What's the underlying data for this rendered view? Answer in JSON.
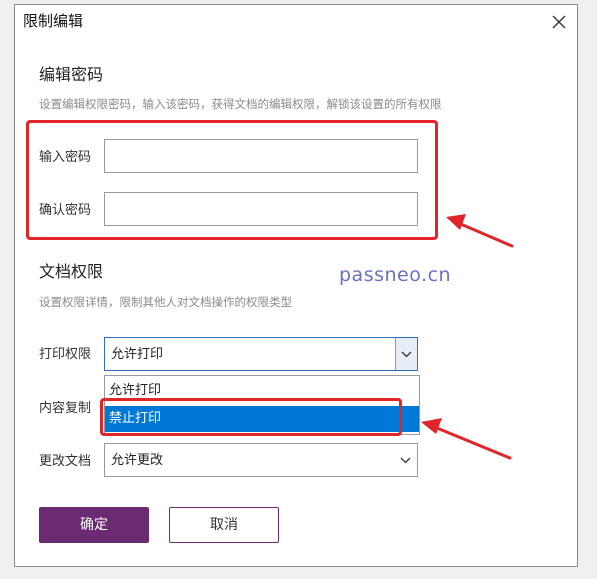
{
  "dialog": {
    "title": "限制编辑"
  },
  "edit_password": {
    "heading": "编辑密码",
    "description": "设置编辑权限密码，输入该密码，获得文档的编辑权限，解锁该设置的所有权限",
    "password_label": "输入密码",
    "password_value": "",
    "confirm_label": "确认密码",
    "confirm_value": ""
  },
  "permissions": {
    "heading": "文档权限",
    "description": "设置权限详情，限制其他人对文档操作的权限类型",
    "print_label": "打印权限",
    "print_value": "允许打印",
    "print_options": [
      "允许打印",
      "禁止打印"
    ],
    "copy_label": "内容复制",
    "modify_label": "更改文档",
    "modify_value": "允许更改"
  },
  "watermark": "passneo.cn",
  "buttons": {
    "ok": "确定",
    "cancel": "取消"
  },
  "colors": {
    "primary": "#6b2a72",
    "selection": "#0078d7",
    "annotation": "#e0262b",
    "watermark": "#6a72c2"
  }
}
